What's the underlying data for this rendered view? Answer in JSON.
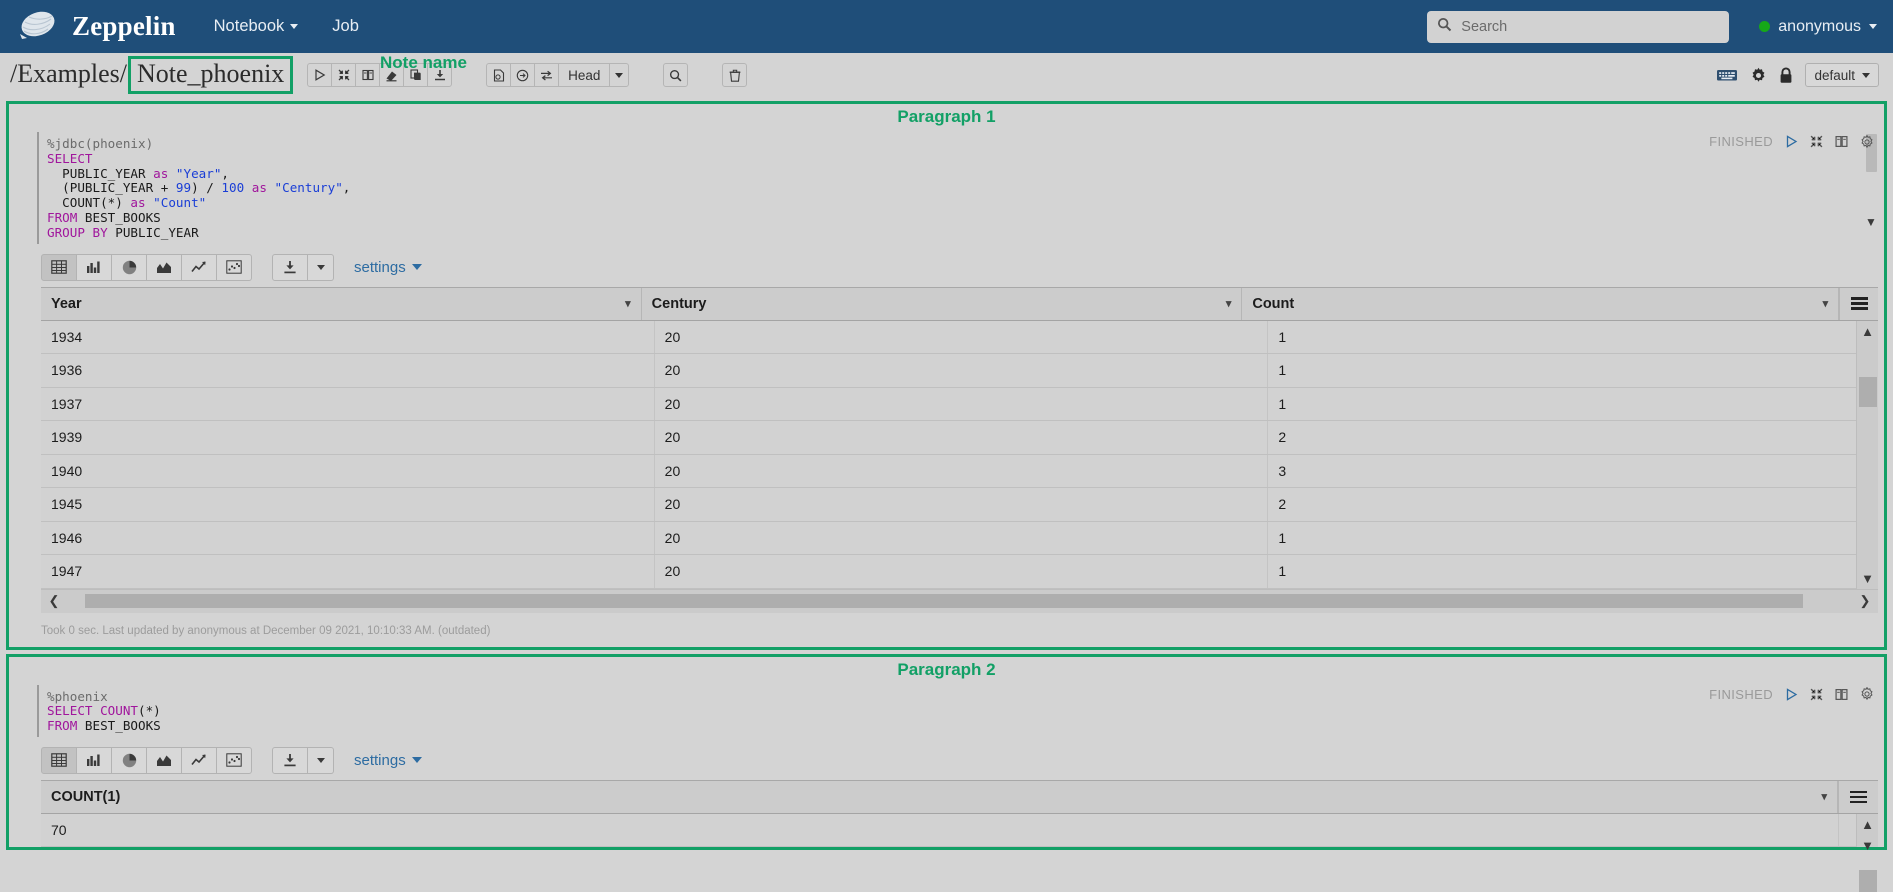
{
  "navbar": {
    "brand": "Zeppelin",
    "logo_icon": "zeppelin-airship-icon",
    "links": [
      {
        "label": "Notebook",
        "has_caret": true
      },
      {
        "label": "Job",
        "has_caret": false
      }
    ],
    "search": {
      "placeholder": "Search",
      "value": "",
      "icon": "search-icon"
    },
    "user": {
      "name": "anonymous",
      "status": "online",
      "status_color": "#16a819"
    },
    "background_color": "#1f4e79"
  },
  "note_bar": {
    "path_prefix": "/Examples/",
    "note_name": "Note_phoenix",
    "toolbar_primary": [
      {
        "icon": "run-all-icon",
        "title": "Run all paragraphs"
      },
      {
        "icon": "collapse-all-icon",
        "title": "Hide all code"
      },
      {
        "icon": "book-icon",
        "title": "Show all output"
      },
      {
        "icon": "eraser-icon",
        "title": "Clear all output"
      },
      {
        "icon": "clone-icon",
        "title": "Clone note"
      },
      {
        "icon": "export-icon",
        "title": "Export note"
      }
    ],
    "toolbar_secondary": [
      {
        "icon": "version-control-icon",
        "title": "Version control"
      },
      {
        "icon": "commit-icon",
        "title": "Commit"
      },
      {
        "icon": "compare-icon",
        "title": "Compare revisions"
      }
    ],
    "revision_label": "Head",
    "search_icon": "search-code-icon",
    "trash_icon": "trash-icon",
    "right_icons": [
      {
        "icon": "keyboard-icon",
        "title": "Keyboard shortcuts"
      },
      {
        "icon": "gear-icon",
        "title": "Interpreter binding"
      },
      {
        "icon": "lock-icon",
        "title": "Note permissions"
      }
    ],
    "interpreter": "default"
  },
  "annotations": {
    "note_name_label": "Note name",
    "paragraph1_label": "Paragraph 1",
    "paragraph2_label": "Paragraph 2",
    "color": "#12a066"
  },
  "paragraph1": {
    "status": "FINISHED",
    "code_lines": [
      {
        "parts": [
          {
            "t": "%jdbc(phoenix)",
            "c": "m"
          }
        ]
      },
      {
        "parts": [
          {
            "t": "SELECT",
            "c": "k"
          }
        ]
      },
      {
        "parts": [
          {
            "t": "  PUBLIC_YEAR ",
            "c": ""
          },
          {
            "t": "as",
            "c": "k"
          },
          {
            "t": " ",
            "c": ""
          },
          {
            "t": "\"Year\"",
            "c": "s"
          },
          {
            "t": ",",
            "c": ""
          }
        ]
      },
      {
        "parts": [
          {
            "t": "  (PUBLIC_YEAR + ",
            "c": ""
          },
          {
            "t": "99",
            "c": "n"
          },
          {
            "t": ") / ",
            "c": ""
          },
          {
            "t": "100",
            "c": "n"
          },
          {
            "t": " ",
            "c": ""
          },
          {
            "t": "as",
            "c": "k"
          },
          {
            "t": " ",
            "c": ""
          },
          {
            "t": "\"Century\"",
            "c": "s"
          },
          {
            "t": ",",
            "c": ""
          }
        ]
      },
      {
        "parts": [
          {
            "t": "  COUNT(*) ",
            "c": ""
          },
          {
            "t": "as",
            "c": "k"
          },
          {
            "t": " ",
            "c": ""
          },
          {
            "t": "\"Count\"",
            "c": "s"
          }
        ]
      },
      {
        "parts": [
          {
            "t": "FROM",
            "c": "k"
          },
          {
            "t": " BEST_BOOKS",
            "c": ""
          }
        ]
      },
      {
        "parts": [
          {
            "t": "GROUP BY",
            "c": "k"
          },
          {
            "t": " PUBLIC_YEAR",
            "c": ""
          }
        ]
      }
    ],
    "viz_buttons": [
      {
        "icon": "table-view-icon",
        "active": true
      },
      {
        "icon": "bar-chart-icon",
        "active": false
      },
      {
        "icon": "pie-chart-icon",
        "active": false
      },
      {
        "icon": "area-chart-icon",
        "active": false
      },
      {
        "icon": "line-chart-icon",
        "active": false
      },
      {
        "icon": "scatter-chart-icon",
        "active": false
      }
    ],
    "download_icon": "download-icon",
    "settings_label": "settings",
    "table": {
      "columns": [
        "Year",
        "Century",
        "Count"
      ],
      "rows": [
        [
          "1934",
          "20",
          "1"
        ],
        [
          "1936",
          "20",
          "1"
        ],
        [
          "1937",
          "20",
          "1"
        ],
        [
          "1939",
          "20",
          "2"
        ],
        [
          "1940",
          "20",
          "3"
        ],
        [
          "1945",
          "20",
          "2"
        ],
        [
          "1946",
          "20",
          "1"
        ],
        [
          "1947",
          "20",
          "1"
        ]
      ]
    },
    "footer": "Took 0 sec. Last updated by anonymous at December 09 2021, 10:10:33 AM. (outdated)"
  },
  "paragraph2": {
    "status": "FINISHED",
    "code_lines": [
      {
        "parts": [
          {
            "t": "%phoenix",
            "c": "m"
          }
        ]
      },
      {
        "parts": [
          {
            "t": "SELECT",
            "c": "k"
          },
          {
            "t": " ",
            "c": ""
          },
          {
            "t": "COUNT",
            "c": "k"
          },
          {
            "t": "(*)",
            "c": ""
          }
        ]
      },
      {
        "parts": [
          {
            "t": "FROM",
            "c": "k"
          },
          {
            "t": " BEST_BOOKS",
            "c": ""
          }
        ]
      }
    ],
    "viz_buttons": [
      {
        "icon": "table-view-icon",
        "active": true
      },
      {
        "icon": "bar-chart-icon",
        "active": false
      },
      {
        "icon": "pie-chart-icon",
        "active": false
      },
      {
        "icon": "area-chart-icon",
        "active": false
      },
      {
        "icon": "line-chart-icon",
        "active": false
      },
      {
        "icon": "scatter-chart-icon",
        "active": false
      }
    ],
    "download_icon": "download-icon",
    "settings_label": "settings",
    "table": {
      "columns": [
        "COUNT(1)"
      ],
      "rows": [
        [
          "70"
        ]
      ]
    }
  },
  "paragraph_controls": [
    {
      "icon": "run-paragraph-icon"
    },
    {
      "icon": "minimize-icon"
    },
    {
      "icon": "book-icon"
    },
    {
      "icon": "gear-icon"
    }
  ]
}
